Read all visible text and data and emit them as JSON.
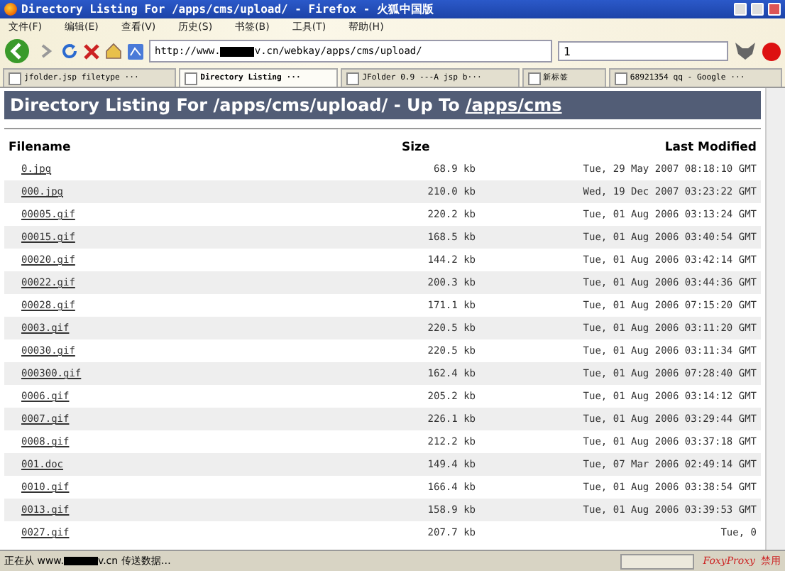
{
  "window": {
    "title": "Directory Listing For /apps/cms/upload/ - Firefox - 火狐中国版"
  },
  "menu": [
    "文件(F)",
    "编辑(E)",
    "查看(V)",
    "历史(S)",
    "书签(B)",
    "工具(T)",
    "帮助(H)"
  ],
  "address": {
    "before_redaction": "http://www.",
    "after_redaction": "v.cn/webkay/apps/cms/upload/"
  },
  "search": {
    "value": "1"
  },
  "tabs": [
    {
      "label": "jfolder.jsp filetype ···",
      "selected": false
    },
    {
      "label": "Directory Listing ···",
      "selected": true
    },
    {
      "label": "JFolder 0.9 ---A jsp b···",
      "selected": false
    },
    {
      "label": "新标签",
      "selected": false
    },
    {
      "label": "68921354 qq - Google ···",
      "selected": false
    }
  ],
  "page": {
    "heading": "Directory Listing For /apps/cms/upload/ - Up To",
    "up_link": "/apps/cms",
    "columns": [
      "Filename",
      "Size",
      "Last Modified"
    ],
    "rows": [
      [
        "0.jpg",
        "68.9 kb",
        "Tue, 29 May 2007 08:18:10 GMT"
      ],
      [
        "000.jpg",
        "210.0 kb",
        "Wed, 19 Dec 2007 03:23:22 GMT"
      ],
      [
        "00005.gif",
        "220.2 kb",
        "Tue, 01 Aug 2006 03:13:24 GMT"
      ],
      [
        "00015.gif",
        "168.5 kb",
        "Tue, 01 Aug 2006 03:40:54 GMT"
      ],
      [
        "00020.gif",
        "144.2 kb",
        "Tue, 01 Aug 2006 03:42:14 GMT"
      ],
      [
        "00022.gif",
        "200.3 kb",
        "Tue, 01 Aug 2006 03:44:36 GMT"
      ],
      [
        "00028.gif",
        "171.1 kb",
        "Tue, 01 Aug 2006 07:15:20 GMT"
      ],
      [
        "0003.gif",
        "220.5 kb",
        "Tue, 01 Aug 2006 03:11:20 GMT"
      ],
      [
        "00030.gif",
        "220.5 kb",
        "Tue, 01 Aug 2006 03:11:34 GMT"
      ],
      [
        "000300.gif",
        "162.4 kb",
        "Tue, 01 Aug 2006 07:28:40 GMT"
      ],
      [
        "0006.gif",
        "205.2 kb",
        "Tue, 01 Aug 2006 03:14:12 GMT"
      ],
      [
        "0007.gif",
        "226.1 kb",
        "Tue, 01 Aug 2006 03:29:44 GMT"
      ],
      [
        "0008.gif",
        "212.2 kb",
        "Tue, 01 Aug 2006 03:37:18 GMT"
      ],
      [
        "001.doc",
        "149.4 kb",
        "Tue, 07 Mar 2006 02:49:14 GMT"
      ],
      [
        "0010.gif",
        "166.4 kb",
        "Tue, 01 Aug 2006 03:38:54 GMT"
      ],
      [
        "0013.gif",
        "158.9 kb",
        "Tue, 01 Aug 2006 03:39:53 GMT"
      ],
      [
        "0027.gif",
        "207.7 kb",
        "Tue, 0"
      ]
    ]
  },
  "status_bar": {
    "before_redaction": "正在从 www.",
    "after_redaction": "v.cn 传送数据…",
    "proxy": "FoxyProxy",
    "proxy_state": "禁用"
  }
}
